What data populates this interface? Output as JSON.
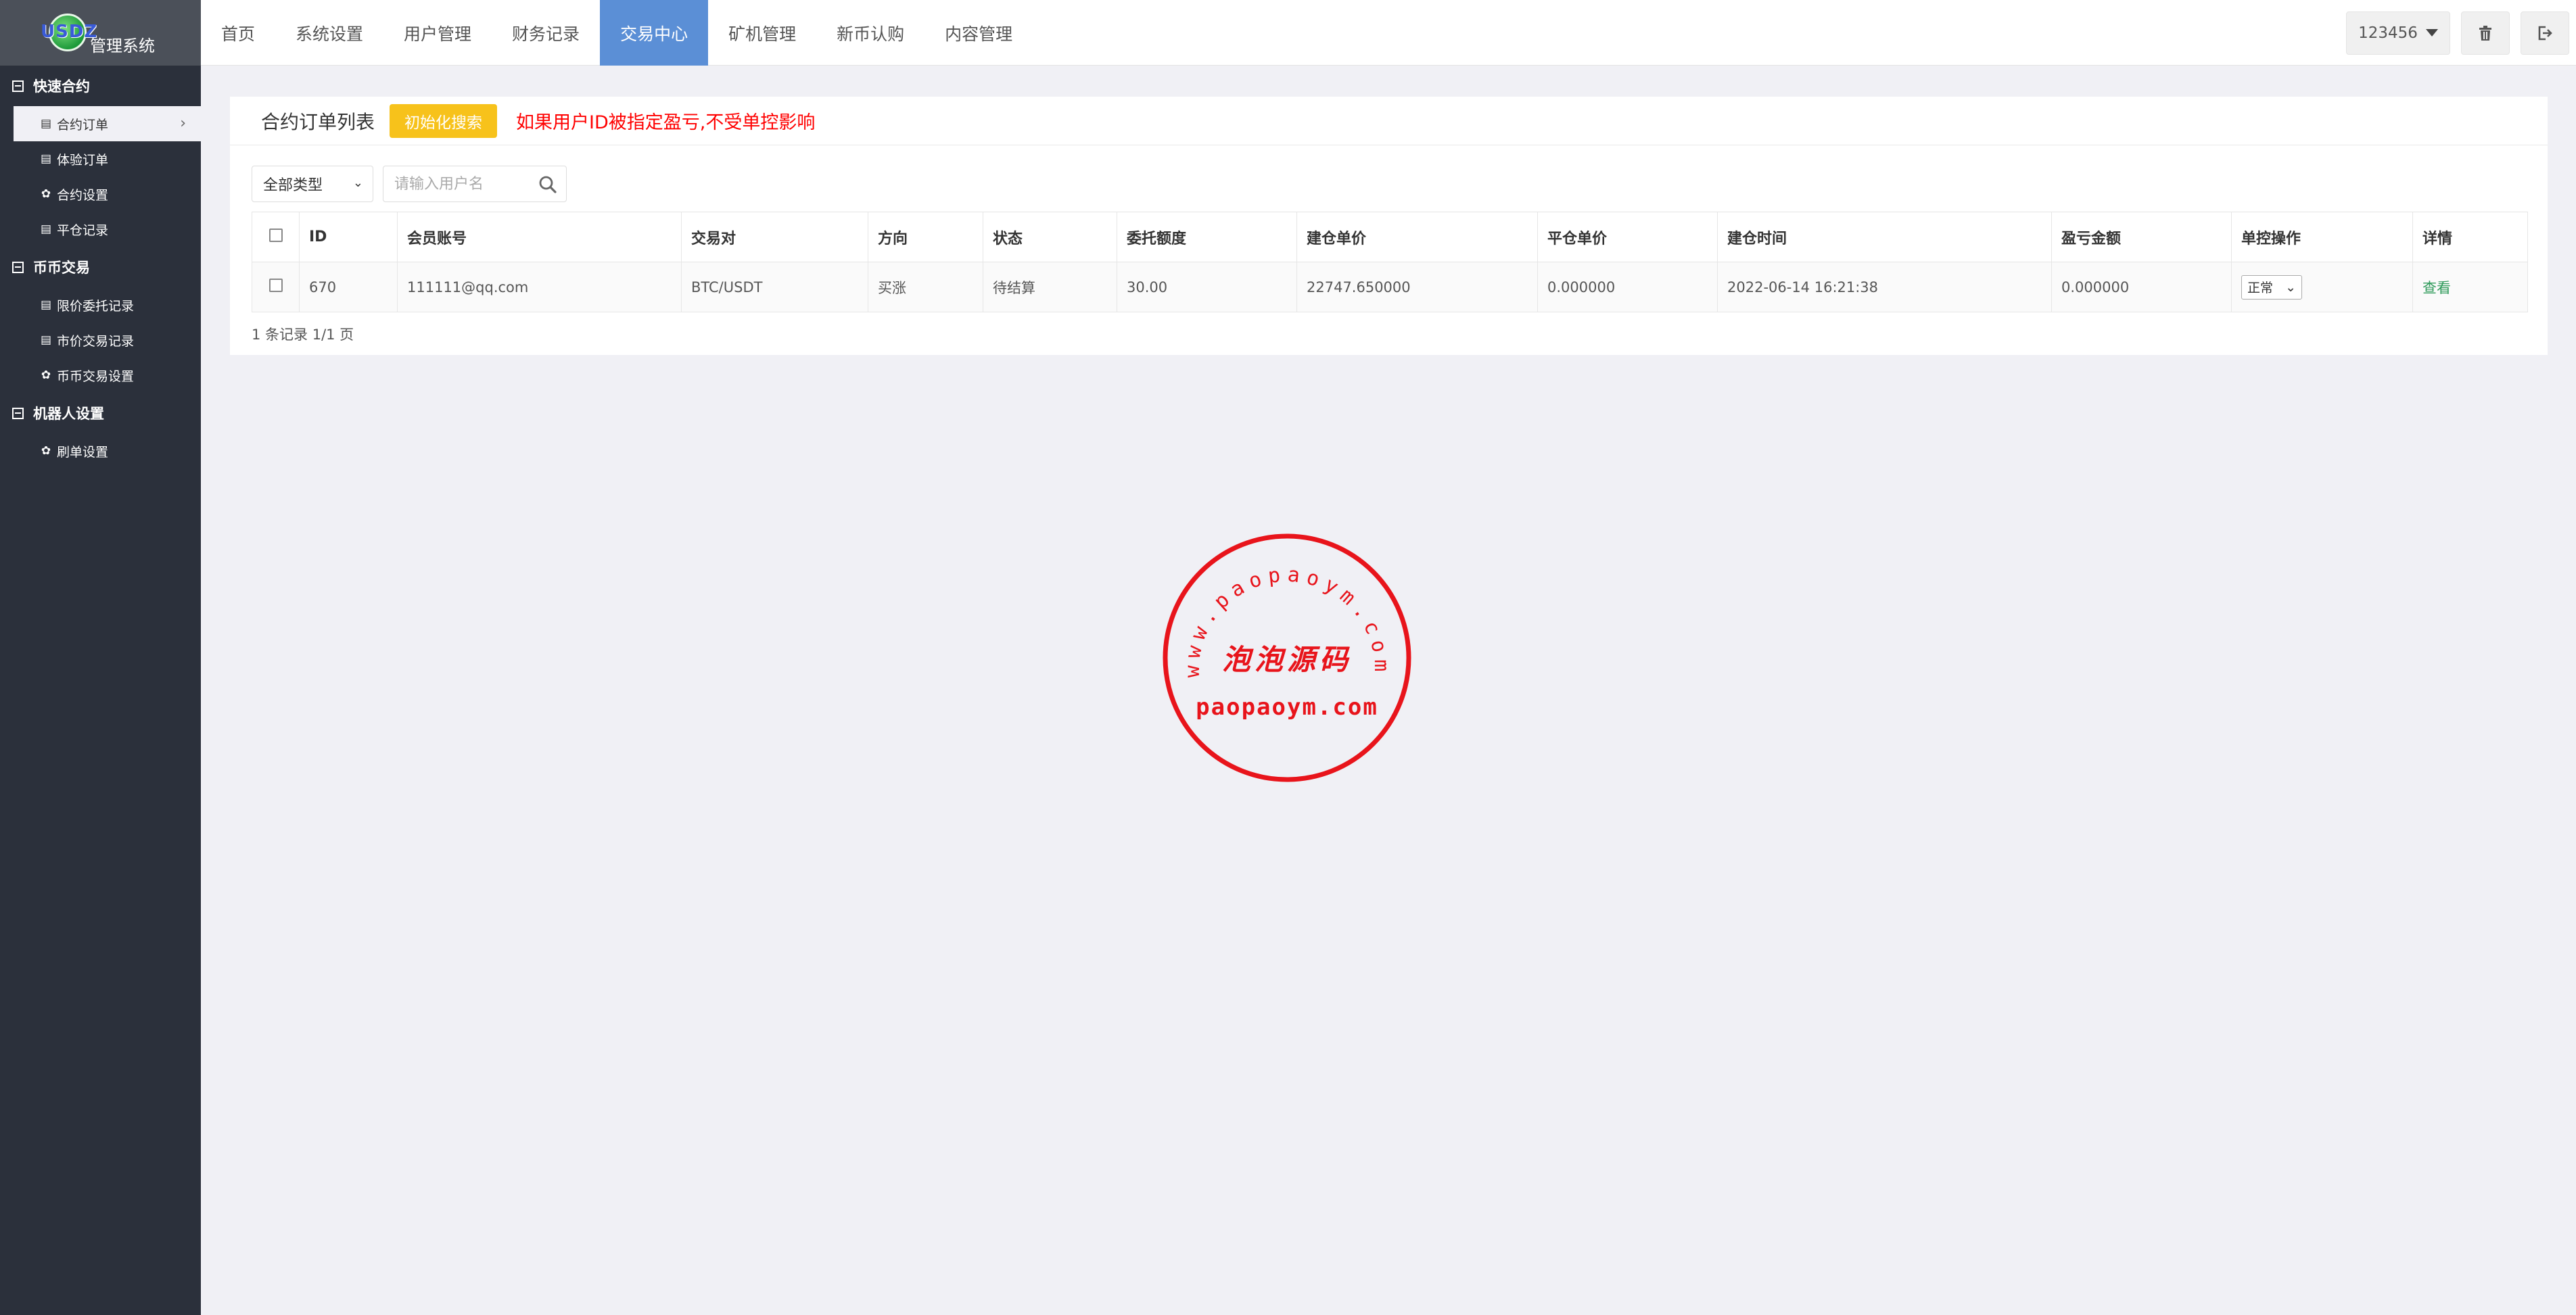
{
  "app": {
    "logo_mark": "USDZ",
    "title": "管理系统"
  },
  "sidebar": {
    "groups": [
      {
        "title": "快速合约",
        "items": [
          {
            "label": "合约订单",
            "icon": "table-icon",
            "active": true
          },
          {
            "label": "体验订单",
            "icon": "table-icon"
          },
          {
            "label": "合约设置",
            "icon": "gear-icon"
          },
          {
            "label": "平仓记录",
            "icon": "table-icon"
          }
        ]
      },
      {
        "title": "币币交易",
        "items": [
          {
            "label": "限价委托记录",
            "icon": "table-icon"
          },
          {
            "label": "市价交易记录",
            "icon": "table-icon"
          },
          {
            "label": "币币交易设置",
            "icon": "gear-icon"
          }
        ]
      },
      {
        "title": "机器人设置",
        "items": [
          {
            "label": "刷单设置",
            "icon": "gear-icon"
          }
        ]
      }
    ]
  },
  "topnav": {
    "items": [
      "首页",
      "系统设置",
      "用户管理",
      "财务记录",
      "交易中心",
      "矿机管理",
      "新币认购",
      "内容管理"
    ],
    "active_index": 4,
    "user": "123456"
  },
  "panel": {
    "title": "合约订单列表",
    "reset_button": "初始化搜索",
    "warning": "如果用户ID被指定盈亏,不受单控影响",
    "filter": {
      "type_selected": "全部类型",
      "search_placeholder": "请输入用户名"
    },
    "table": {
      "columns": [
        "ID",
        "会员账号",
        "交易对",
        "方向",
        "状态",
        "委托额度",
        "建仓单价",
        "平仓单价",
        "建仓时间",
        "盈亏金额",
        "单控操作",
        "详情"
      ],
      "rows": [
        {
          "id": "670",
          "account": "111111@qq.com",
          "pair": "BTC/USDT",
          "direction": "买涨",
          "status": "待结算",
          "amount": "30.00",
          "open_price": "22747.650000",
          "close_price": "0.000000",
          "open_time": "2022-06-14 16:21:38",
          "pnl": "0.000000",
          "control": "正常",
          "detail": "查看"
        }
      ]
    },
    "pager": "1 条记录 1/1 页"
  },
  "watermark": {
    "arc_text": "www.paopaoym.com",
    "center_text": "泡泡源码",
    "bottom_text": "paopaoym.com",
    "color": "#e8141b"
  },
  "colors": {
    "sidebar_bg": "#2b303b",
    "nav_active": "#5b8fd6",
    "reset_button": "#f7c21b",
    "warning": "#ff0000",
    "buy": "#3bb46b"
  }
}
